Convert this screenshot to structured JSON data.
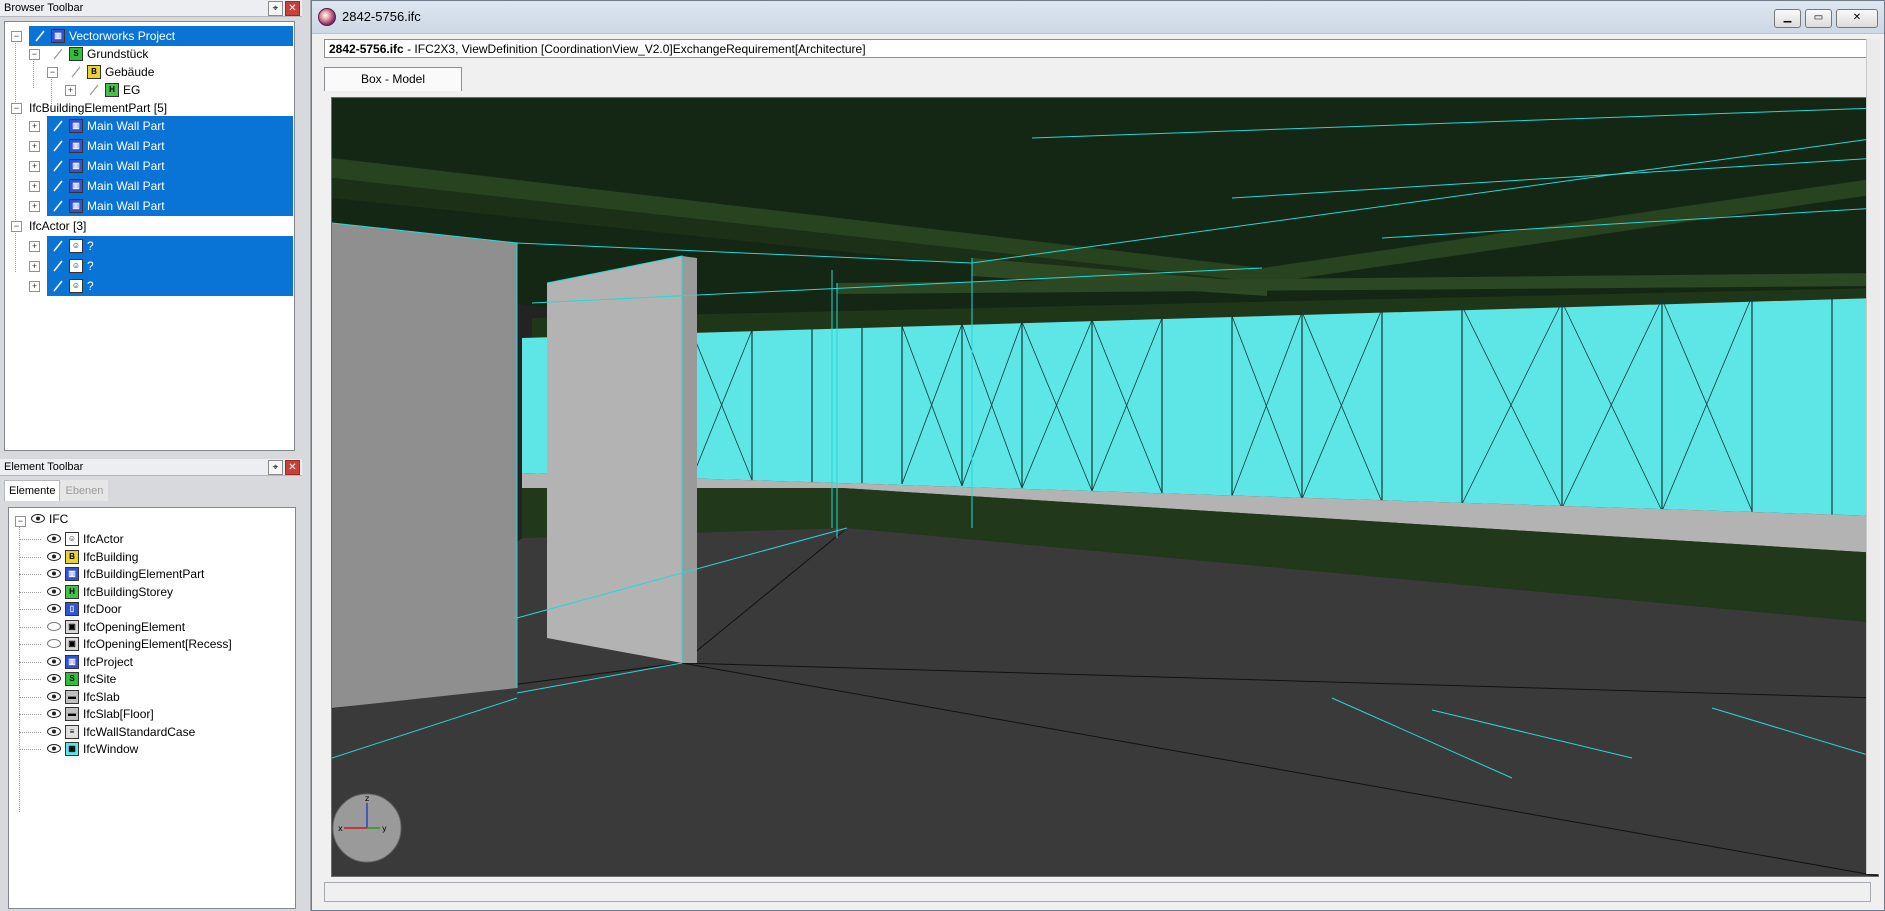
{
  "browser_toolbar": {
    "title": "Browser Toolbar",
    "pin_symbol": "⌖",
    "close_symbol": "✕",
    "tree": [
      {
        "label": "Vectorworks Project",
        "icon": "project-icon",
        "selected": true
      },
      {
        "label": "Grundstück",
        "icon": "site-icon",
        "selected": false
      },
      {
        "label": "Gebäude",
        "icon": "building-icon",
        "selected": false
      },
      {
        "label": "EG",
        "icon": "storey-icon",
        "selected": false
      },
      {
        "label": "IfcBuildingElementPart [5]",
        "icon": "",
        "selected": false
      },
      {
        "label": "Main Wall Part",
        "icon": "element-part-icon",
        "selected": true
      },
      {
        "label": "Main Wall Part",
        "icon": "element-part-icon",
        "selected": true
      },
      {
        "label": "Main Wall Part",
        "icon": "element-part-icon",
        "selected": true
      },
      {
        "label": "Main Wall Part",
        "icon": "element-part-icon",
        "selected": true
      },
      {
        "label": "Main Wall Part",
        "icon": "element-part-icon",
        "selected": true
      },
      {
        "label": "IfcActor [3]",
        "icon": "",
        "selected": false
      },
      {
        "label": "?",
        "icon": "actor-icon",
        "selected": true
      },
      {
        "label": "?",
        "icon": "actor-icon",
        "selected": true
      },
      {
        "label": "?",
        "icon": "actor-icon",
        "selected": true
      }
    ]
  },
  "element_toolbar": {
    "title": "Element Toolbar",
    "tabs": [
      "Elemente",
      "Ebenen"
    ],
    "root": "IFC",
    "items": [
      {
        "label": "IfcActor",
        "icon": "actor-icon",
        "visible": true
      },
      {
        "label": "IfcBuilding",
        "icon": "building-icon",
        "visible": true
      },
      {
        "label": "IfcBuildingElementPart",
        "icon": "element-part-icon",
        "visible": true
      },
      {
        "label": "IfcBuildingStorey",
        "icon": "storey-icon",
        "visible": true
      },
      {
        "label": "IfcDoor",
        "icon": "door-icon",
        "visible": true
      },
      {
        "label": "IfcOpeningElement",
        "icon": "opening-icon",
        "visible": false
      },
      {
        "label": "IfcOpeningElement[Recess]",
        "icon": "opening-icon",
        "visible": false
      },
      {
        "label": "IfcProject",
        "icon": "project-icon",
        "visible": true
      },
      {
        "label": "IfcSite",
        "icon": "site-icon",
        "visible": true
      },
      {
        "label": "IfcSlab",
        "icon": "slab-icon",
        "visible": true
      },
      {
        "label": "IfcSlab[Floor]",
        "icon": "slab-icon",
        "visible": true
      },
      {
        "label": "IfcWallStandardCase",
        "icon": "wall-icon",
        "visible": true
      },
      {
        "label": "IfcWindow",
        "icon": "window-icon",
        "visible": true
      }
    ]
  },
  "main_window": {
    "title": "2842-5756.ifc",
    "min_symbol": "▁",
    "max_symbol": "▭",
    "close_symbol": "✕",
    "info_file": "2842-5756.ifc",
    "info_rest": " - IFC2X3, ViewDefinition [CoordinationView_V2.0]ExchangeRequirement[Architecture]",
    "view_tab": "Box - Model",
    "gizmo_labels": {
      "z": "z",
      "x": "x",
      "y": "y"
    }
  },
  "colors": {
    "selection": "#0a74d6",
    "ceiling": "#142614",
    "wall_green": "#22381a",
    "floor": "#3a3a3a",
    "window_cyan": "#5ee6e6",
    "edge_cyan": "#27d7d7",
    "partition_gray": "#b3b3b3"
  }
}
